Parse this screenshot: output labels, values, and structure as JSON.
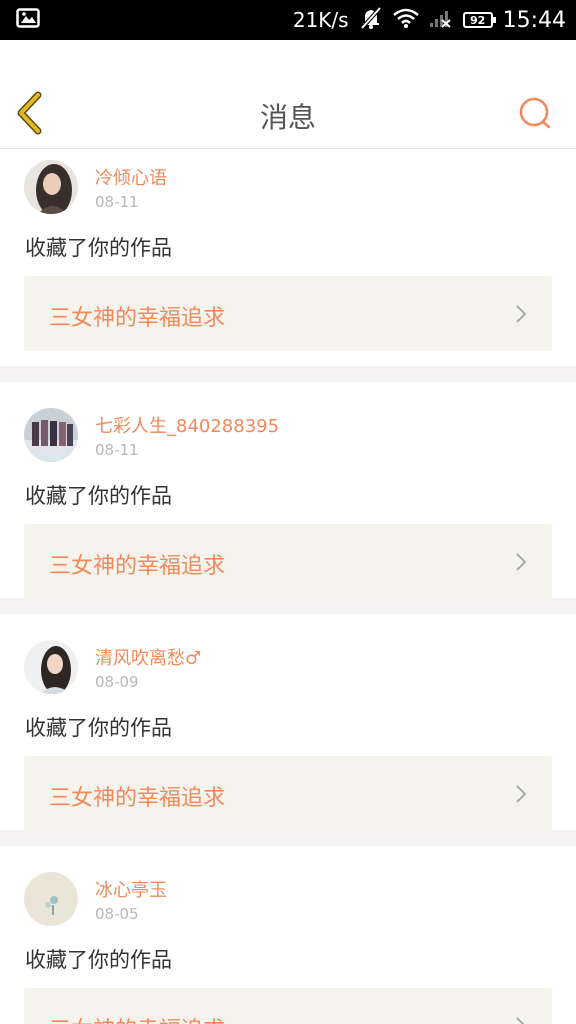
{
  "status_bar": {
    "speed": "21K/s",
    "battery": "92",
    "time": "15:44"
  },
  "header": {
    "title": "消息"
  },
  "messages": [
    {
      "user": "冷倾心语",
      "date": "08-11",
      "action": "收藏了你的作品",
      "work_title": "三女神的幸福追求"
    },
    {
      "user": "七彩人生_840288395",
      "date": "08-11",
      "action": "收藏了你的作品",
      "work_title": "三女神的幸福追求"
    },
    {
      "user": "清风吹离愁♂",
      "date": "08-09",
      "action": "收藏了你的作品",
      "work_title": "三女神的幸福追求"
    },
    {
      "user": "冰心亭玉",
      "date": "08-05",
      "action": "收藏了你的作品",
      "work_title": "三女神的幸福追求"
    }
  ],
  "colors": {
    "accent": "#f08a5d",
    "back_arrow": "#c9a21c",
    "card_bg": "#f4f3ec",
    "separator": "#f5f3f3"
  },
  "icons": {
    "back": "chevron-left-icon",
    "search": "search-icon",
    "card_arrow": "chevron-right-icon",
    "image_notification": "image-icon",
    "mute": "bell-off-icon",
    "wifi": "wifi-icon",
    "signal": "signal-icon",
    "battery": "battery-icon"
  }
}
